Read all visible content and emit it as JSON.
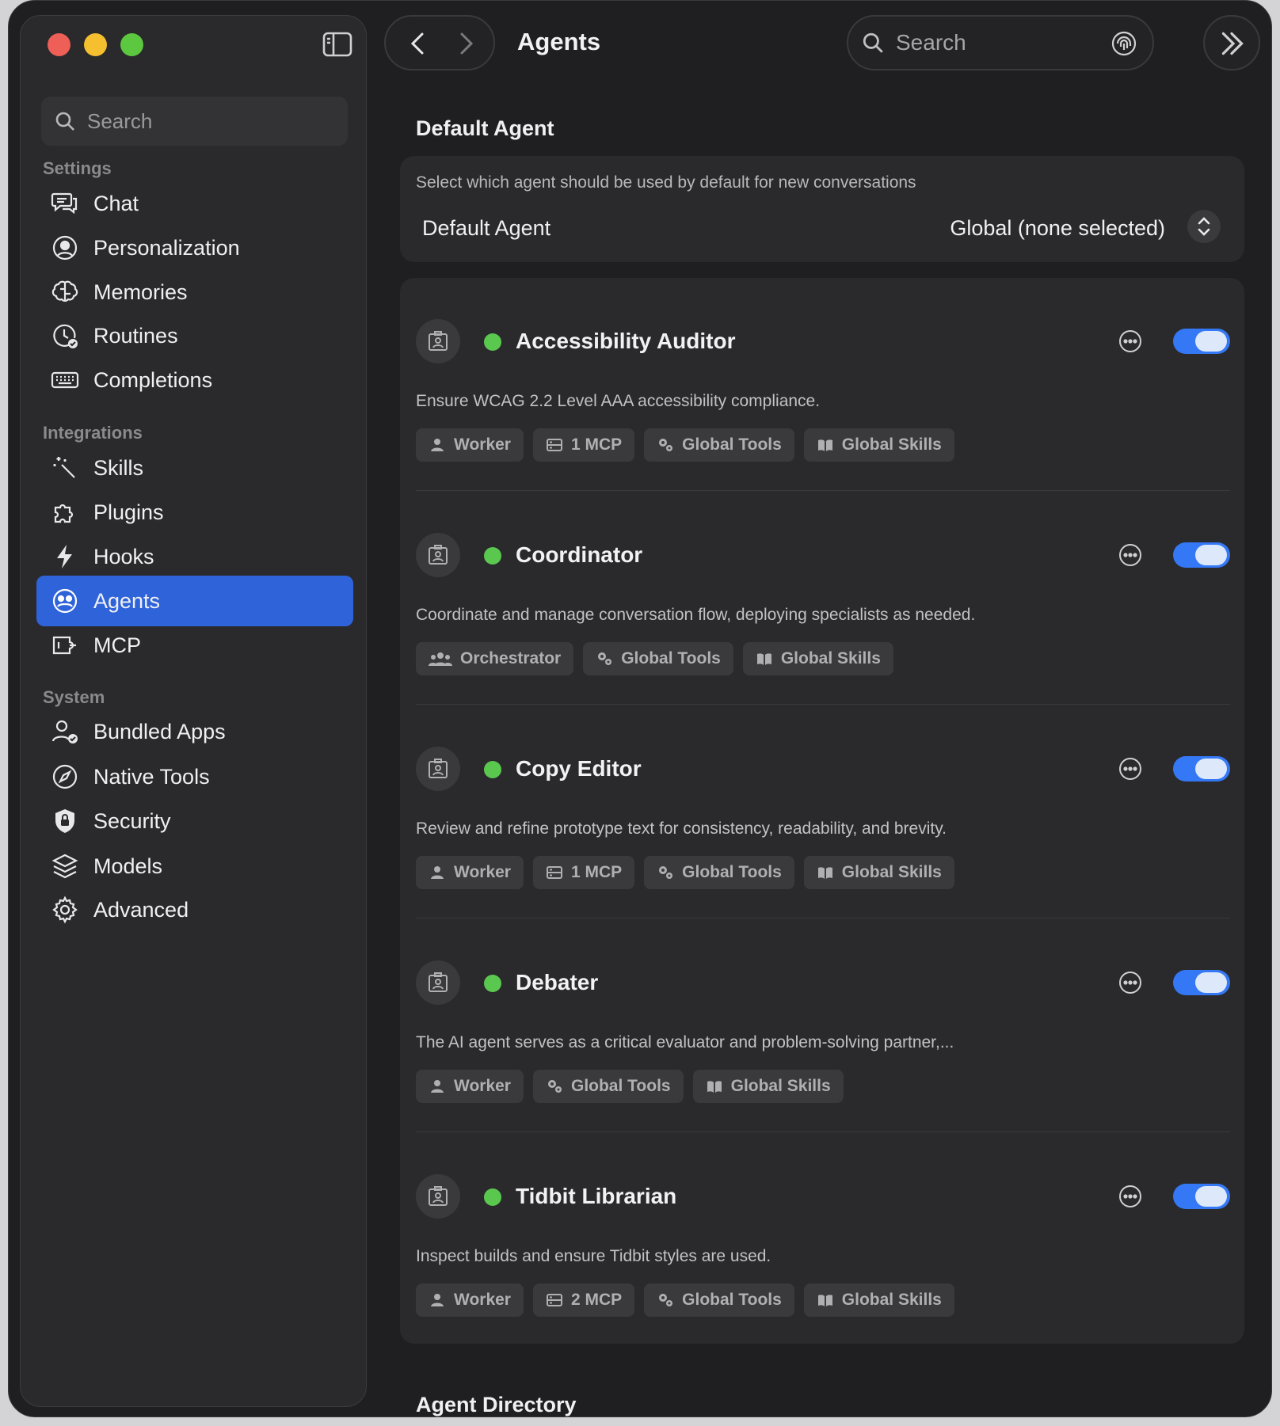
{
  "app": {
    "page_title": "Agents",
    "top_search_placeholder": "Search"
  },
  "sidebar": {
    "search_placeholder": "Search",
    "sections": [
      {
        "label": "Settings",
        "items": [
          {
            "label": "Chat",
            "icon": "chat-bubbles-icon"
          },
          {
            "label": "Personalization",
            "icon": "person-circle-icon"
          },
          {
            "label": "Memories",
            "icon": "brain-icon"
          },
          {
            "label": "Routines",
            "icon": "clock-check-icon"
          },
          {
            "label": "Completions",
            "icon": "keyboard-icon"
          }
        ]
      },
      {
        "label": "Integrations",
        "items": [
          {
            "label": "Skills",
            "icon": "magic-wand-icon"
          },
          {
            "label": "Plugins",
            "icon": "puzzle-icon"
          },
          {
            "label": "Hooks",
            "icon": "bolt-icon"
          },
          {
            "label": "Agents",
            "icon": "agents-icon",
            "active": true
          },
          {
            "label": "MCP",
            "icon": "mcp-icon"
          }
        ]
      },
      {
        "label": "System",
        "items": [
          {
            "label": "Bundled Apps",
            "icon": "person-check-icon"
          },
          {
            "label": "Native Tools",
            "icon": "compass-icon"
          },
          {
            "label": "Security",
            "icon": "lock-shield-icon"
          },
          {
            "label": "Models",
            "icon": "layers-icon"
          },
          {
            "label": "Advanced",
            "icon": "gear-icon"
          }
        ]
      }
    ]
  },
  "default_agent": {
    "heading": "Default Agent",
    "description": "Select which agent should be used by default for new conversations",
    "label": "Default Agent",
    "value": "Global (none selected)"
  },
  "agents": [
    {
      "name": "Accessibility Auditor",
      "enabled": true,
      "description": "Ensure WCAG 2.2 Level AAA accessibility compliance.",
      "tags": [
        {
          "label": "Worker",
          "icon": "person-icon"
        },
        {
          "label": "1 MCP",
          "icon": "server-icon"
        },
        {
          "label": "Global Tools",
          "icon": "gears-icon"
        },
        {
          "label": "Global Skills",
          "icon": "book-icon"
        }
      ]
    },
    {
      "name": "Coordinator",
      "enabled": true,
      "description": "Coordinate and manage conversation flow, deploying specialists as needed.",
      "tags": [
        {
          "label": "Orchestrator",
          "icon": "group-icon"
        },
        {
          "label": "Global Tools",
          "icon": "gears-icon"
        },
        {
          "label": "Global Skills",
          "icon": "book-icon"
        }
      ]
    },
    {
      "name": "Copy Editor",
      "enabled": true,
      "description": "Review and refine prototype text for consistency, readability, and brevity.",
      "tags": [
        {
          "label": "Worker",
          "icon": "person-icon"
        },
        {
          "label": "1 MCP",
          "icon": "server-icon"
        },
        {
          "label": "Global Tools",
          "icon": "gears-icon"
        },
        {
          "label": "Global Skills",
          "icon": "book-icon"
        }
      ]
    },
    {
      "name": "Debater",
      "enabled": true,
      "description": "The AI agent serves as a critical evaluator and problem-solving partner,...",
      "tags": [
        {
          "label": "Worker",
          "icon": "person-icon"
        },
        {
          "label": "Global Tools",
          "icon": "gears-icon"
        },
        {
          "label": "Global Skills",
          "icon": "book-icon"
        }
      ]
    },
    {
      "name": "Tidbit Librarian",
      "enabled": true,
      "description": "Inspect builds and ensure Tidbit styles are used.",
      "tags": [
        {
          "label": "Worker",
          "icon": "person-icon"
        },
        {
          "label": "2 MCP",
          "icon": "server-icon"
        },
        {
          "label": "Global Tools",
          "icon": "gears-icon"
        },
        {
          "label": "Global Skills",
          "icon": "book-icon"
        }
      ]
    }
  ],
  "agent_directory": {
    "heading": "Agent Directory"
  },
  "colors": {
    "accent": "#2f63d9",
    "toggle_on": "#3478f6",
    "status_active": "#5ac84f"
  }
}
